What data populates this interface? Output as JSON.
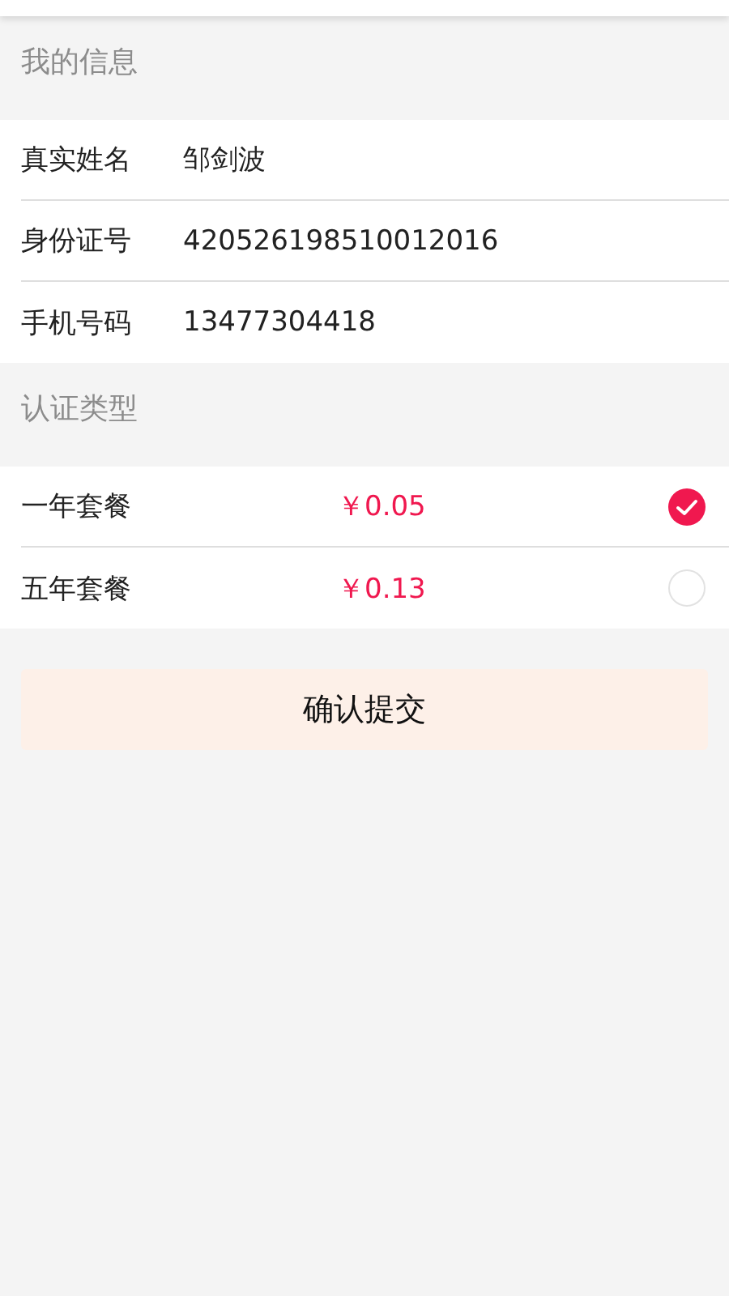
{
  "info_section": {
    "title": "我的信息",
    "fields": [
      {
        "label": "真实姓名",
        "value": "邹剑波"
      },
      {
        "label": "身份证号",
        "value": "420526198510012016"
      },
      {
        "label": "手机号码",
        "value": "13477304418"
      }
    ]
  },
  "plan_section": {
    "title": "认证类型",
    "plans": [
      {
        "name": "一年套餐",
        "price": "￥0.05",
        "selected": true
      },
      {
        "name": "五年套餐",
        "price": "￥0.13",
        "selected": false
      }
    ]
  },
  "submit_button": "确认提交"
}
